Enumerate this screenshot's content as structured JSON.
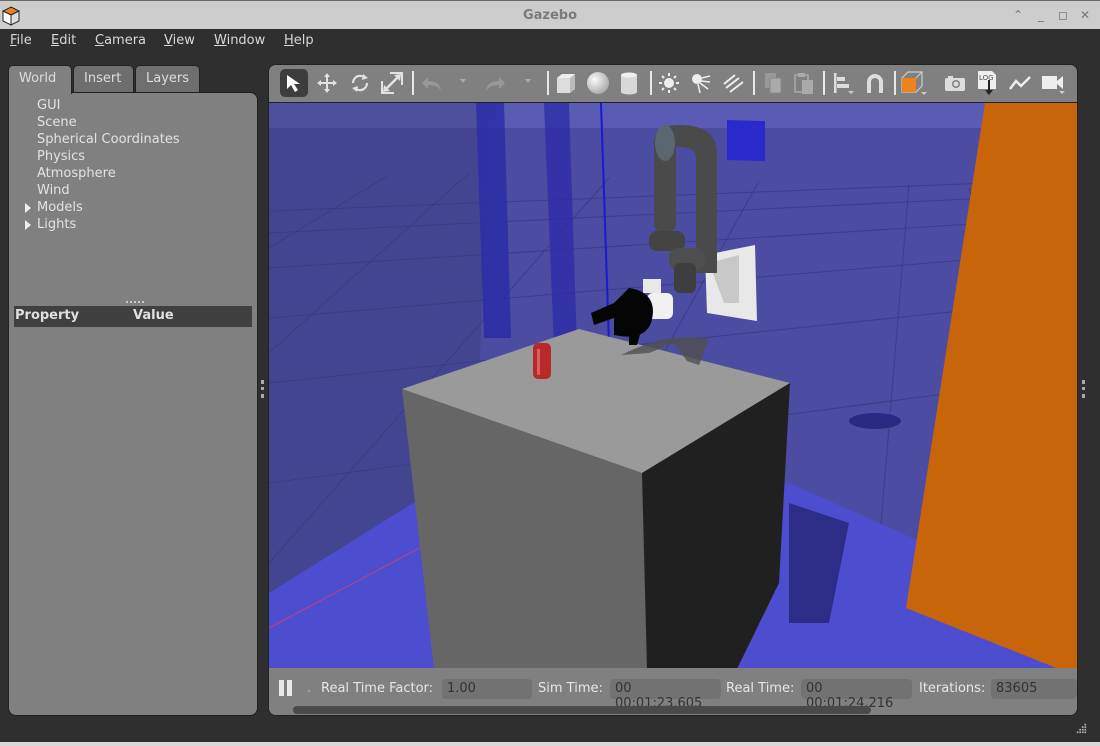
{
  "window": {
    "title": "Gazebo",
    "controls": [
      "shade",
      "minimize",
      "maximize",
      "close"
    ]
  },
  "menubar": {
    "items": [
      {
        "label": "File",
        "mnemonic": "F"
      },
      {
        "label": "Edit",
        "mnemonic": "E"
      },
      {
        "label": "Camera",
        "mnemonic": "C"
      },
      {
        "label": "View",
        "mnemonic": "V"
      },
      {
        "label": "Window",
        "mnemonic": "W"
      },
      {
        "label": "Help",
        "mnemonic": "H"
      }
    ]
  },
  "left_panel": {
    "tabs": [
      {
        "label": "World",
        "active": true
      },
      {
        "label": "Insert",
        "active": false
      },
      {
        "label": "Layers",
        "active": false
      }
    ],
    "tree": [
      {
        "label": "GUI",
        "expandable": false
      },
      {
        "label": "Scene",
        "expandable": false
      },
      {
        "label": "Spherical Coordinates",
        "expandable": false
      },
      {
        "label": "Physics",
        "expandable": false
      },
      {
        "label": "Atmosphere",
        "expandable": false
      },
      {
        "label": "Wind",
        "expandable": false
      },
      {
        "label": "Models",
        "expandable": true
      },
      {
        "label": "Lights",
        "expandable": true
      }
    ],
    "property_table": {
      "columns": [
        "Property",
        "Value"
      ]
    }
  },
  "toolbar": {
    "tools": [
      {
        "name": "select-mode",
        "icon": "arrow-cursor-icon",
        "active": true
      },
      {
        "name": "translate-mode",
        "icon": "move-arrows-icon"
      },
      {
        "name": "rotate-mode",
        "icon": "rotate-icon"
      },
      {
        "name": "scale-mode",
        "icon": "scale-icon"
      },
      {
        "name": "undo",
        "icon": "undo-icon",
        "disabled": true
      },
      {
        "name": "redo",
        "icon": "redo-icon",
        "disabled": true
      },
      {
        "name": "box",
        "icon": "box-icon"
      },
      {
        "name": "sphere",
        "icon": "sphere-icon"
      },
      {
        "name": "cylinder",
        "icon": "cylinder-icon"
      },
      {
        "name": "point-light",
        "icon": "point-light-icon"
      },
      {
        "name": "spot-light",
        "icon": "spot-light-icon"
      },
      {
        "name": "directional-light",
        "icon": "directional-light-icon"
      },
      {
        "name": "copy",
        "icon": "copy-icon",
        "disabled": true
      },
      {
        "name": "paste",
        "icon": "paste-icon",
        "disabled": true
      },
      {
        "name": "align",
        "icon": "align-icon"
      },
      {
        "name": "snap",
        "icon": "magnet-icon"
      },
      {
        "name": "view-angle",
        "icon": "view-cube-icon"
      },
      {
        "name": "screenshot",
        "icon": "camera-icon"
      },
      {
        "name": "log",
        "icon": "log-icon",
        "text": "LOG"
      },
      {
        "name": "plot",
        "icon": "plot-icon"
      },
      {
        "name": "video-record",
        "icon": "video-camera-icon"
      }
    ],
    "accent_color": "#f0821e"
  },
  "scene": {
    "background_color": "#4b4ca2",
    "objects": [
      "ground-grid",
      "blue-transparent-walls",
      "orange-wall",
      "table-box",
      "soda-can",
      "ur-robot-arm",
      "gripper",
      "wall-mount-plate"
    ]
  },
  "status_bar": {
    "paused": false,
    "real_time_factor_label": "Real Time Factor:",
    "real_time_factor": "1.00",
    "sim_time_label": "Sim Time:",
    "sim_time": "00 00:01:23.605",
    "real_time_label": "Real Time:",
    "real_time": "00 00:01:24.216",
    "iterations_label": "Iterations:",
    "iterations": "83605",
    "dot": "."
  }
}
